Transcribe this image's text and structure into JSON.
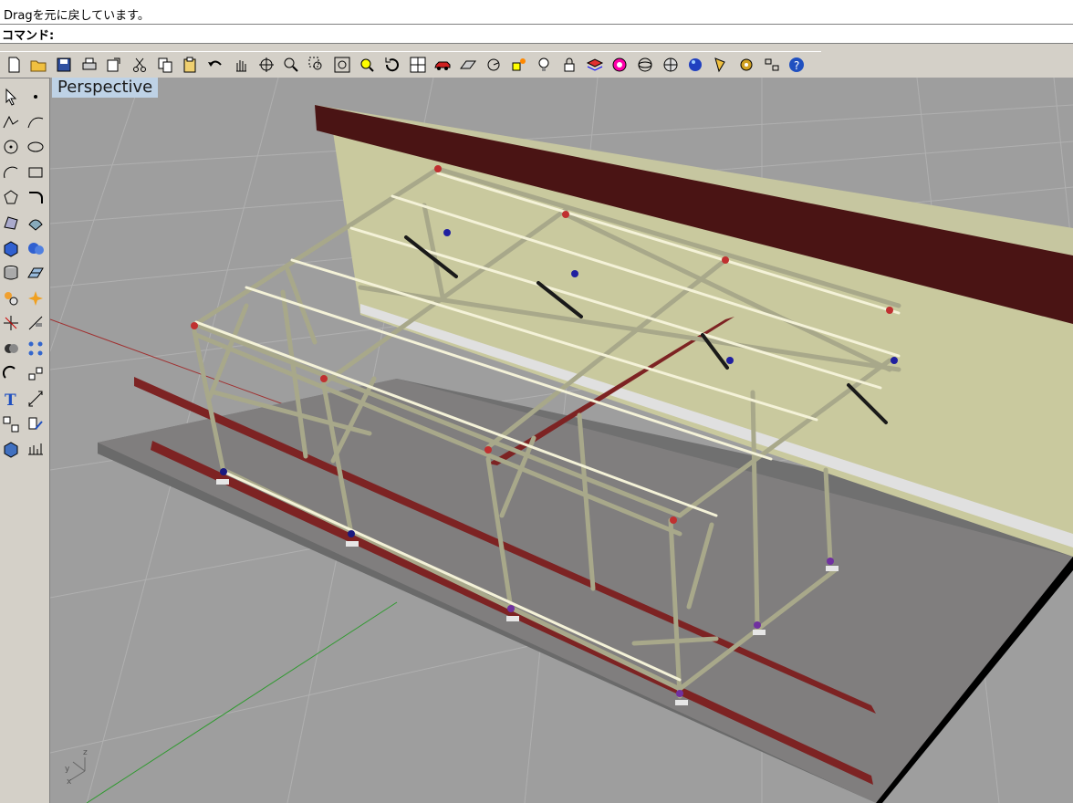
{
  "history_line": "Dragを元に戻しています。",
  "command_prompt": "コマンド:",
  "viewport": {
    "label": "Perspective"
  },
  "axis_labels": {
    "z": "z",
    "y": "y",
    "x": "x"
  },
  "toolbar": [
    {
      "icon": "new-file-icon"
    },
    {
      "icon": "open-folder-icon"
    },
    {
      "icon": "save-icon"
    },
    {
      "icon": "print-icon"
    },
    {
      "icon": "export-icon"
    },
    {
      "icon": "cut-icon"
    },
    {
      "icon": "copy-icon"
    },
    {
      "icon": "paste-icon"
    },
    {
      "icon": "undo-icon"
    },
    {
      "icon": "pan-hand-icon"
    },
    {
      "icon": "rotate-view-icon"
    },
    {
      "icon": "zoom-dynamic-icon"
    },
    {
      "icon": "zoom-window-icon"
    },
    {
      "icon": "zoom-extents-icon"
    },
    {
      "icon": "zoom-selected-icon"
    },
    {
      "icon": "undo-view-icon"
    },
    {
      "icon": "four-viewports-icon"
    },
    {
      "icon": "car-icon"
    },
    {
      "icon": "grid-plane-icon"
    },
    {
      "icon": "snap-icon"
    },
    {
      "icon": "osnap-icon"
    },
    {
      "icon": "light-bulb-icon"
    },
    {
      "icon": "lock-icon"
    },
    {
      "icon": "layer-icon"
    },
    {
      "icon": "color-wheel-icon"
    },
    {
      "icon": "wireframe-sphere-icon"
    },
    {
      "icon": "render-mesh-icon"
    },
    {
      "icon": "render-sphere-icon"
    },
    {
      "icon": "material-icon"
    },
    {
      "icon": "options-gear-icon"
    },
    {
      "icon": "properties-icon"
    },
    {
      "icon": "help-icon"
    }
  ],
  "left_tools": [
    {
      "icon": "select-arrow-icon"
    },
    {
      "icon": "point-icon"
    },
    {
      "icon": "polyline-icon"
    },
    {
      "icon": "curve-icon"
    },
    {
      "icon": "circle-icon"
    },
    {
      "icon": "ellipse-icon"
    },
    {
      "icon": "arc-icon"
    },
    {
      "icon": "rectangle-icon"
    },
    {
      "icon": "polygon-icon"
    },
    {
      "icon": "fillet-icon"
    },
    {
      "icon": "surface-icon"
    },
    {
      "icon": "surface-edit-icon"
    },
    {
      "icon": "box-solid-icon"
    },
    {
      "icon": "sphere-solid-icon"
    },
    {
      "icon": "cylinder-icon"
    },
    {
      "icon": "mesh-icon"
    },
    {
      "icon": "transform-icon"
    },
    {
      "icon": "explode-icon"
    },
    {
      "icon": "trim-icon"
    },
    {
      "icon": "split-icon"
    },
    {
      "icon": "boolean-icon"
    },
    {
      "icon": "array-icon"
    },
    {
      "icon": "rotate-icon"
    },
    {
      "icon": "scale-icon"
    },
    {
      "icon": "text-icon"
    },
    {
      "icon": "dimension-icon"
    },
    {
      "icon": "group-icon"
    },
    {
      "icon": "edit-point-icon"
    },
    {
      "icon": "block-icon"
    },
    {
      "icon": "analyze-icon"
    }
  ]
}
